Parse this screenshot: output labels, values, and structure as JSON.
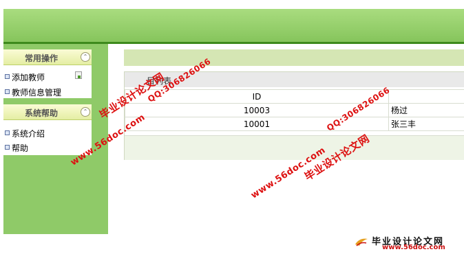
{
  "sidebar": {
    "panels": [
      {
        "title": "常用操作",
        "items": [
          "添加教师",
          "教师信息管理"
        ]
      },
      {
        "title": "系统帮助",
        "items": [
          "系统介绍",
          "帮助"
        ]
      }
    ]
  },
  "main": {
    "list_title": " 目列表",
    "columns": [
      "ID",
      ""
    ],
    "rows": [
      {
        "id": "10003",
        "name": "杨过"
      },
      {
        "id": "10001",
        "name": "张三丰"
      }
    ]
  },
  "watermarks": {
    "site_name": "毕业设计论文网",
    "qq": "QQ:306826066",
    "url": "www.56doc.com"
  },
  "logo": {
    "name": "毕业设计论文网",
    "url": "www.56doc.com"
  },
  "colors": {
    "header": "#8fca68",
    "accent_bar": "#3d8a1c",
    "watermark": "#dd1111"
  }
}
